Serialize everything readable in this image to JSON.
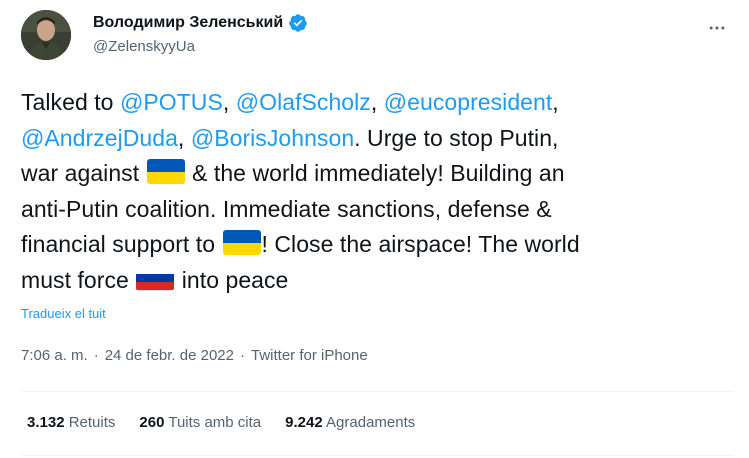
{
  "author": {
    "name": "Володимир Зеленський",
    "handle": "@ZelenskyyUa"
  },
  "tweet": {
    "segments": [
      {
        "type": "text",
        "value": "Talked to "
      },
      {
        "type": "mention",
        "value": "@POTUS"
      },
      {
        "type": "text",
        "value": ", "
      },
      {
        "type": "mention",
        "value": "@OlafScholz"
      },
      {
        "type": "text",
        "value": ", "
      },
      {
        "type": "mention",
        "value": "@eucopresident"
      },
      {
        "type": "text",
        "value": ", "
      },
      {
        "type": "br"
      },
      {
        "type": "mention",
        "value": "@AndrzejDuda"
      },
      {
        "type": "text",
        "value": ", "
      },
      {
        "type": "mention",
        "value": "@BorisJohnson"
      },
      {
        "type": "text",
        "value": ". Urge to stop Putin,"
      },
      {
        "type": "br"
      },
      {
        "type": "text",
        "value": "war against "
      },
      {
        "type": "flag",
        "value": "ukraine"
      },
      {
        "type": "text",
        "value": " & the world immediately! Building an"
      },
      {
        "type": "br"
      },
      {
        "type": "text",
        "value": "anti-Putin coalition. Immediate sanctions, defense &"
      },
      {
        "type": "br"
      },
      {
        "type": "text",
        "value": "financial support to "
      },
      {
        "type": "flag",
        "value": "ukraine"
      },
      {
        "type": "text",
        "value": "! Close the airspace! The world"
      },
      {
        "type": "br"
      },
      {
        "type": "text",
        "value": "must force "
      },
      {
        "type": "flag",
        "value": "russia"
      },
      {
        "type": "text",
        "value": " into peace"
      }
    ],
    "translate_label": "Tradueix el tuit"
  },
  "meta": {
    "time": "7:06 a. m.",
    "separator": "·",
    "date": "24 de febr. de 2022",
    "source": "Twitter for iPhone"
  },
  "stats": [
    {
      "value": "3.132",
      "label": "Retuits"
    },
    {
      "value": "260",
      "label": "Tuits amb cita"
    },
    {
      "value": "9.242",
      "label": "Agradaments"
    }
  ],
  "colors": {
    "accent": "#1d9bf0",
    "text": "#0f1419",
    "secondary": "#536471",
    "divider": "#eff3f4"
  },
  "icons": {
    "verified": "verified-badge-icon",
    "more": "more-horizontal-icon"
  },
  "flags": {
    "ukraine": [
      "#0057b7",
      "#ffd700"
    ],
    "russia": [
      "#ffffff",
      "#0039a6",
      "#d52b1e"
    ]
  }
}
